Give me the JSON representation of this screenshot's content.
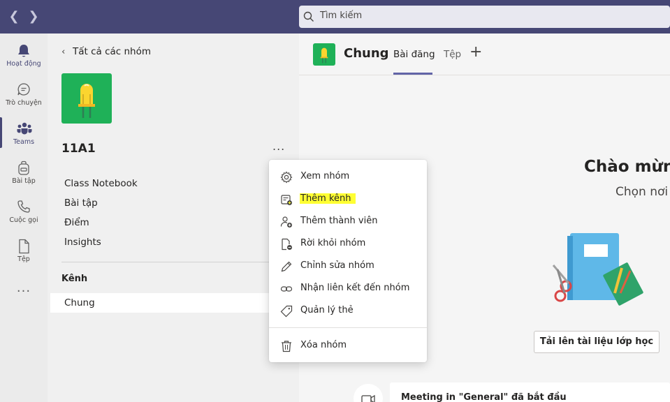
{
  "search": {
    "placeholder": "Tìm kiếm"
  },
  "rail": {
    "items": [
      {
        "label": "Hoạt động"
      },
      {
        "label": "Trò chuyện"
      },
      {
        "label": "Teams"
      },
      {
        "label": "Bài tập"
      },
      {
        "label": "Cuộc gọi"
      },
      {
        "label": "Tệp"
      }
    ],
    "more": "..."
  },
  "panel": {
    "back_label": "Tất cả các nhóm",
    "team_name": "11A1",
    "more": "...",
    "links": [
      "Class Notebook",
      "Bài tập",
      "Điểm",
      "Insights"
    ],
    "channels_title": "Kênh",
    "channels": [
      "Chung"
    ]
  },
  "main": {
    "channel_title": "Chung",
    "tabs": [
      "Bài đăng",
      "Tệp"
    ],
    "welcome": "Chào mừng",
    "welcome_sub": "Chọn nơi",
    "upload_button": "Tải lên tài liệu lớp học",
    "meeting_text": "Meeting in \"General\" đã bắt đầu"
  },
  "context_menu": {
    "items": [
      {
        "label": "Xem nhóm",
        "icon": "gear-icon"
      },
      {
        "label": "Thêm kênh",
        "icon": "add-channel-icon",
        "highlighted": true
      },
      {
        "label": "Thêm thành viên",
        "icon": "add-member-icon"
      },
      {
        "label": "Rời khỏi nhóm",
        "icon": "leave-team-icon"
      },
      {
        "label": "Chỉnh sửa nhóm",
        "icon": "pencil-icon"
      },
      {
        "label": "Nhận liên kết đến nhóm",
        "icon": "link-icon"
      },
      {
        "label": "Quản lý thẻ",
        "icon": "tag-icon"
      },
      {
        "label": "Xóa nhóm",
        "icon": "trash-icon"
      }
    ]
  },
  "colors": {
    "brand": "#464775",
    "accent": "#6264a7",
    "team_avatar": "#1fb158",
    "highlight": "#ffff33"
  }
}
